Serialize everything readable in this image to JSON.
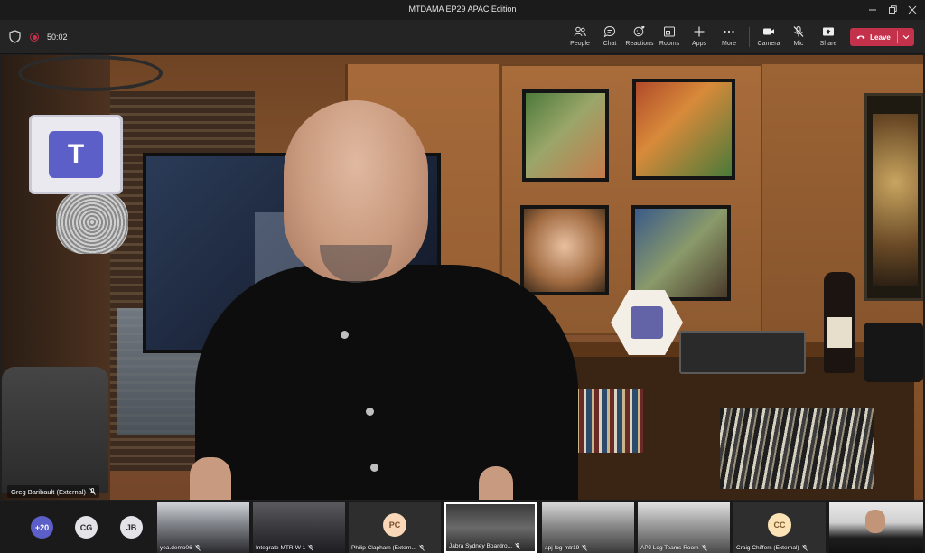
{
  "window": {
    "title": "MTDAMA EP29 APAC Edition"
  },
  "toolbar": {
    "timer": "50:02",
    "buttons": [
      {
        "label": "People",
        "icon": "people-icon"
      },
      {
        "label": "Chat",
        "icon": "chat-icon"
      },
      {
        "label": "Reactions",
        "icon": "reactions-icon"
      },
      {
        "label": "Rooms",
        "icon": "rooms-icon"
      },
      {
        "label": "Apps",
        "icon": "apps-plus-icon"
      },
      {
        "label": "More",
        "icon": "more-icon"
      },
      {
        "label": "Camera",
        "icon": "camera-icon"
      },
      {
        "label": "Mic",
        "icon": "mic-off-icon"
      },
      {
        "label": "Share",
        "icon": "share-icon"
      }
    ],
    "leave_label": "Leave"
  },
  "main_video": {
    "speaker_name": "Greg Baribault (External)",
    "speaker_mic_state": "muted"
  },
  "participants": {
    "overflow_count": "+20",
    "initials_avatars": [
      "CG",
      "JB"
    ],
    "tiles": [
      {
        "name": "yea.demo06",
        "type": "video"
      },
      {
        "name": "Integrate MTR-W 1",
        "type": "video"
      },
      {
        "name": "Philip Clapham (Extern...",
        "type": "avatar",
        "initials": "PC"
      },
      {
        "name": "Jabra Sydney Boardro...",
        "type": "video"
      },
      {
        "name": "apj-log-mtr19",
        "type": "video"
      },
      {
        "name": "APJ Log Teams Room",
        "type": "video"
      },
      {
        "name": "Craig Chiffers (External)",
        "type": "avatar",
        "initials": "CC"
      },
      {
        "name": "",
        "type": "video"
      }
    ]
  },
  "colors": {
    "leave": "#c4314b",
    "recording": "#c4314b",
    "overflow_avatar": "#5b5fc7",
    "pc_avatar": "#f8d8b8",
    "cc_avatar": "#fbe3b6"
  }
}
